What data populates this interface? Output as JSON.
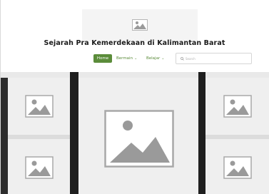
{
  "header": {
    "logo_icon": "image-placeholder-icon",
    "title": "Sejarah Pra Kemerdekaan di Kalimantan Barat"
  },
  "nav": {
    "items": [
      {
        "label": "Home",
        "active": true
      },
      {
        "label": "Bermain",
        "dropdown": true
      },
      {
        "label": "Belajar",
        "dropdown": true
      }
    ],
    "chevron_icon": "chevron-down-icon"
  },
  "search": {
    "placeholder": "Search",
    "icon": "search-icon"
  },
  "gallery": {
    "tiles": [
      {
        "icon": "image-placeholder-icon"
      },
      {
        "icon": "image-placeholder-icon"
      },
      {
        "icon": "image-placeholder-icon"
      },
      {
        "icon": "image-placeholder-icon"
      },
      {
        "icon": "image-placeholder-icon"
      }
    ]
  },
  "colors": {
    "accent": "#5b8c3a",
    "placeholder_bg": "#efefef",
    "placeholder_fg": "#9a9a9a",
    "gallery_bg": "#3a3a3a"
  }
}
